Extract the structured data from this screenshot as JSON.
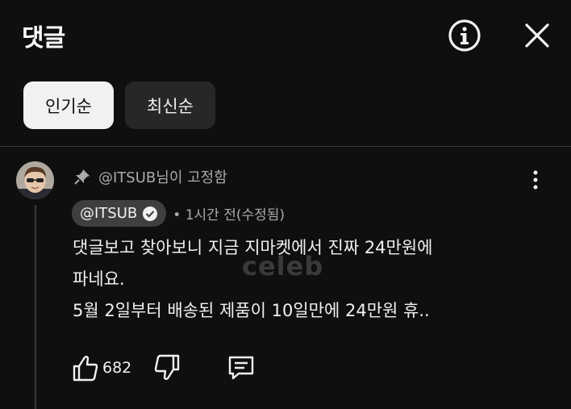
{
  "header": {
    "title": "댓글",
    "info_icon": "info-icon",
    "close_icon": "close-icon"
  },
  "sort_chips": [
    {
      "label": "인기순",
      "selected": true
    },
    {
      "label": "최신순",
      "selected": false
    }
  ],
  "comment": {
    "pinned_text": "@ITSUB님이 고정함",
    "author": "@ITSUB",
    "time": "• 1시간 전(수정됨)",
    "lines": [
      "댓글보고 찾아보니 지금 지마켓에서 진짜 24만원에",
      "파네요.",
      "5월 2일부터 배송된 제품이 10일만에 24만원 휴.."
    ],
    "like_count": "682",
    "watermark": "celeb"
  },
  "colors": {
    "background": "#0f0f0f",
    "chip_selected": "#f1f1f1",
    "chip_unselected": "#272727",
    "badge": "#3f3f3f",
    "secondary_text": "#aaaaaa"
  }
}
